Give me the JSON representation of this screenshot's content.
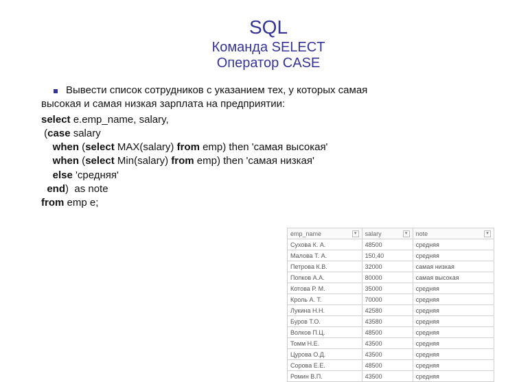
{
  "title": {
    "main": "SQL",
    "sub1": "Команда SELECT",
    "sub2": "Оператор CASE"
  },
  "bullet": {
    "line1": "Вывести список сотрудников с указанием тех, у которых самая",
    "line2": "высокая и самая низкая зарплата на предприятии:"
  },
  "code": {
    "kw_select": "select",
    "l1_rest": " e.emp_name, salary,",
    "l2_open": " (",
    "kw_case": "case",
    "l2_rest": " salary",
    "indent3": "    ",
    "kw_when1": "when",
    "l3_a": " (",
    "kw_select_i": "select",
    "l3_b": " MAX(salary) ",
    "kw_from_i": "from",
    "l3_c": " emp) then 'самая высокая'",
    "kw_when2": "when",
    "l4_b": " Min(salary) ",
    "l4_c": " emp) then 'самая низкая'",
    "kw_else": "else",
    "l5_rest": " 'средняя'",
    "indent_end": "  ",
    "kw_end": "end",
    "l6_rest": ")  as note",
    "kw_from": "from",
    "l7_rest": " emp e;"
  },
  "table": {
    "headers": [
      "emp_name",
      "salary",
      "note"
    ],
    "rows": [
      [
        "Сухова К. А.",
        "48500",
        "средняя"
      ],
      [
        "Малова Т. А.",
        "150,40",
        "средняя"
      ],
      [
        "Петрова К.В.",
        "32000",
        "самая низкая"
      ],
      [
        "Попков А.А.",
        "80000",
        "самая высокая"
      ],
      [
        "Котова Р. М.",
        "35000",
        "средняя"
      ],
      [
        "Кроль А. Т.",
        "70000",
        "средняя"
      ],
      [
        "Лукина Н.Н.",
        "42580",
        "средняя"
      ],
      [
        "Буров Т.О.",
        "43580",
        "средняя"
      ],
      [
        "Волков П.Ц.",
        "48500",
        "средняя"
      ],
      [
        "Томм Н.Е.",
        "43500",
        "средняя"
      ],
      [
        "Цурова О.Д.",
        "43500",
        "средняя"
      ],
      [
        "Сорова Е.Е.",
        "48500",
        "средняя"
      ],
      [
        "Ромин В.П.",
        "43500",
        "средняя"
      ]
    ]
  }
}
